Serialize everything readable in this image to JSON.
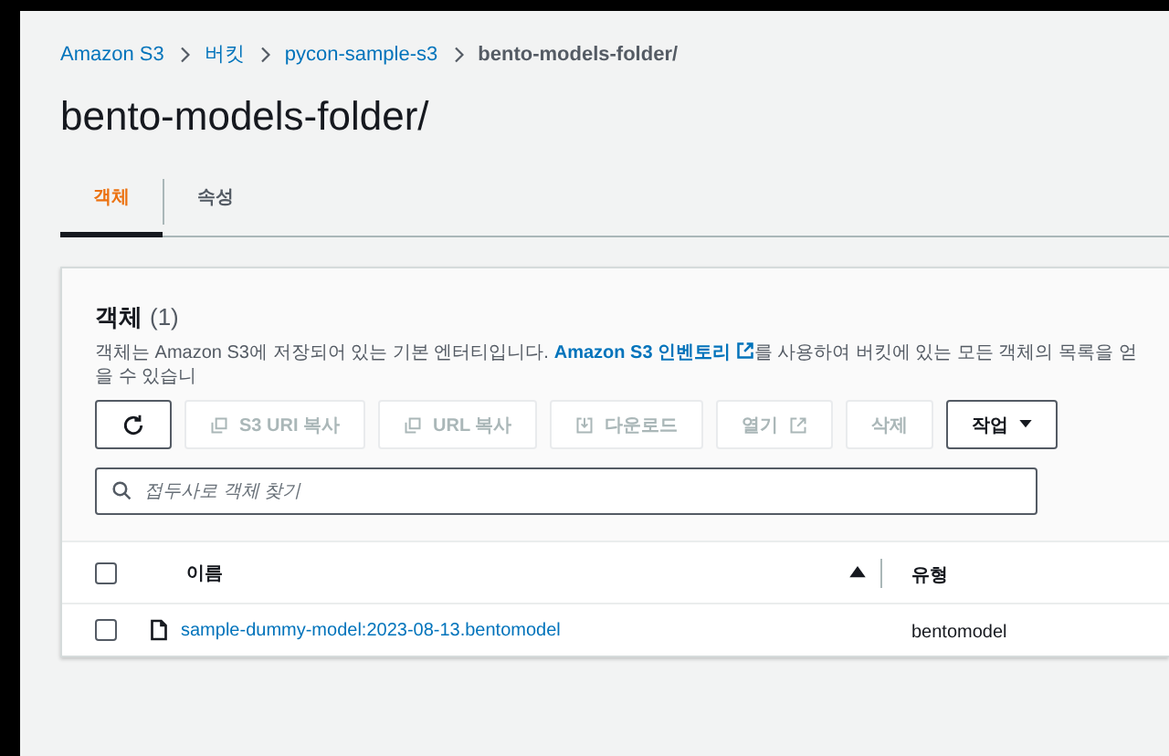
{
  "breadcrumb": [
    {
      "label": "Amazon S3",
      "current": false
    },
    {
      "label": "버킷",
      "current": false
    },
    {
      "label": "pycon-sample-s3",
      "current": false
    },
    {
      "label": "bento-models-folder/",
      "current": true
    }
  ],
  "title": "bento-models-folder/",
  "tabs": [
    {
      "label": "객체",
      "selected": true
    },
    {
      "label": "속성",
      "selected": false
    }
  ],
  "objects_panel": {
    "heading": "객체",
    "count": "(1)",
    "description": {
      "before": "객체는 Amazon S3에 저장되어 있는 기본 엔터티입니다.",
      "link": "Amazon S3 인벤토리",
      "after": "를 사용하여 버킷에 있는 모든 객체의 목록을 얻을 수 있습니"
    },
    "toolbar": [
      {
        "kind": "refresh",
        "disabled": false
      },
      {
        "kind": "copy",
        "label": "S3 URI 복사",
        "disabled": true
      },
      {
        "kind": "copy",
        "label": "URL 복사",
        "disabled": true
      },
      {
        "kind": "download",
        "label": "다운로드",
        "disabled": true
      },
      {
        "kind": "open",
        "label": "열기",
        "disabled": true
      },
      {
        "kind": "plain",
        "label": "삭제",
        "disabled": true
      },
      {
        "kind": "menu",
        "label": "작업",
        "disabled": false
      }
    ],
    "search": {
      "placeholder": "접두사로 객체 찾기"
    },
    "table": {
      "select_all_checked": false,
      "columns": [
        {
          "label": "이름",
          "sorted": true
        },
        {
          "label": "유형",
          "sorted": false
        }
      ],
      "rows": [
        {
          "checked": false,
          "name": "sample-dummy-model:2023-08-13.bentomodel",
          "type": "bentomodel"
        }
      ]
    }
  }
}
